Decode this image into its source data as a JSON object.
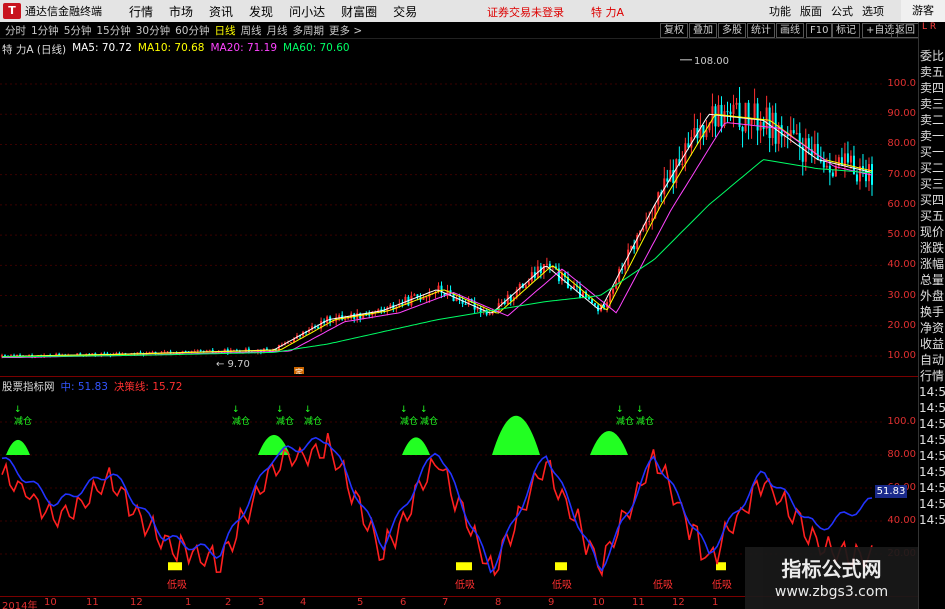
{
  "titlebar": {
    "logo": "T",
    "app_name": "通达信金融终端",
    "menu": [
      "行情",
      "市场",
      "资讯",
      "发现",
      "问小达",
      "财富圈",
      "交易"
    ],
    "notice": "证券交易未登录",
    "stock_name": "特 力A",
    "right_menu": [
      "功能",
      "版面",
      "公式",
      "选项"
    ],
    "guest": "游客"
  },
  "toolbar": {
    "periods": [
      "分时",
      "1分钟",
      "5分钟",
      "15分钟",
      "30分钟",
      "60分钟",
      "日线",
      "周线",
      "月线",
      "多周期",
      "更多 >"
    ],
    "active_period": "日线",
    "right_buttons": [
      "复权",
      "叠加",
      "多股",
      "统计",
      "画线",
      "F10",
      "标记",
      "+自选",
      "返回"
    ]
  },
  "price_header": {
    "title": "特 力A (日线)",
    "ma5": "MA5: 70.72",
    "ma10": "MA10: 70.68",
    "ma20": "MA20: 71.19",
    "ma60": "MA60: 70.60"
  },
  "price_axis": [
    "100.0",
    "90.00",
    "80.00",
    "70.00",
    "60.00",
    "50.00",
    "40.00",
    "30.00",
    "20.00",
    "10.00"
  ],
  "price_annotations": {
    "high": "108.00",
    "low": "9.70",
    "marker": "定"
  },
  "indicator_header": {
    "name": "股票指标网",
    "line1": "中: 51.83",
    "line2": "决策线: 15.72"
  },
  "indicator_axis": [
    "100.0",
    "80.00",
    "60.00",
    "40.00",
    "20.00"
  ],
  "indicator_value_badge": "51.83",
  "indicator_labels": {
    "buy": "低吸",
    "reduce": "减仓"
  },
  "right_panel": {
    "top": "L R",
    "items": [
      "委比",
      "卖五",
      "卖四",
      "卖三",
      "卖二",
      "卖一",
      "买一",
      "买二",
      "买三",
      "买四",
      "买五",
      "现价",
      "涨跌",
      "涨幅",
      "总量",
      "外盘",
      "换手",
      "净资",
      "收益",
      "自动",
      "行情",
      "14:5",
      "14:5",
      "14:5",
      "14:5",
      "14:5",
      "14:5",
      "14:5",
      "14:5",
      "14:5"
    ]
  },
  "time_axis": [
    "2014年",
    "10",
    "11",
    "12",
    "1",
    "2",
    "3",
    "4",
    "5",
    "6",
    "7",
    "8",
    "9",
    "10",
    "11",
    "12",
    "1"
  ],
  "watermark": {
    "line1": "指标公式网",
    "line2": "www.zbgs3.com"
  },
  "colors": {
    "price_axis": "#e03030",
    "up_candle": "#ff3030",
    "down_candle": "#00ffff",
    "ma5": "#ffffff",
    "ma10": "#ffff00",
    "ma20": "#ff44ff",
    "ma60": "#00ff66",
    "ind_blue": "#2233ff",
    "ind_red": "#ff2020",
    "zone_green": "#22ff22",
    "zone_yellow": "#ffff00"
  },
  "chart_data": [
    {
      "type": "line",
      "title": "特 力A (日线)",
      "x": [
        "2014-09",
        "2014-10",
        "2014-11",
        "2014-12",
        "2015-01",
        "2015-02",
        "2015-03",
        "2015-04",
        "2015-05",
        "2015-06",
        "2015-07",
        "2015-08",
        "2015-09",
        "2015-10",
        "2015-11",
        "2015-12",
        "2016-01"
      ],
      "series": [
        {
          "name": "MA5",
          "values": [
            9.8,
            10.2,
            10.5,
            11,
            11.5,
            12,
            22,
            25,
            32,
            24,
            40,
            25,
            60,
            90,
            88,
            75,
            70.72
          ]
        },
        {
          "name": "MA60",
          "values": [
            9.7,
            9.9,
            10.1,
            10.4,
            10.8,
            11.2,
            14,
            18,
            22,
            25,
            28,
            30,
            42,
            60,
            75,
            72,
            70.6
          ]
        }
      ],
      "ylim": [
        5,
        110
      ]
    },
    {
      "type": "line",
      "title": "股票指标网",
      "x": [
        "2014-09",
        "2014-10",
        "2014-11",
        "2014-12",
        "2015-01",
        "2015-02",
        "2015-03",
        "2015-04",
        "2015-05",
        "2015-06",
        "2015-07",
        "2015-08",
        "2015-09",
        "2015-10",
        "2015-11",
        "2015-12",
        "2016-01"
      ],
      "series": [
        {
          "name": "中",
          "values": [
            78,
            50,
            70,
            30,
            20,
            80,
            90,
            25,
            85,
            10,
            82,
            10,
            80,
            20,
            70,
            35,
            51.83
          ]
        },
        {
          "name": "决策线",
          "values": [
            70,
            40,
            65,
            25,
            15,
            75,
            85,
            20,
            78,
            8,
            75,
            12,
            78,
            15,
            65,
            25,
            15.72
          ]
        }
      ],
      "ylim": [
        0,
        110
      ]
    }
  ]
}
